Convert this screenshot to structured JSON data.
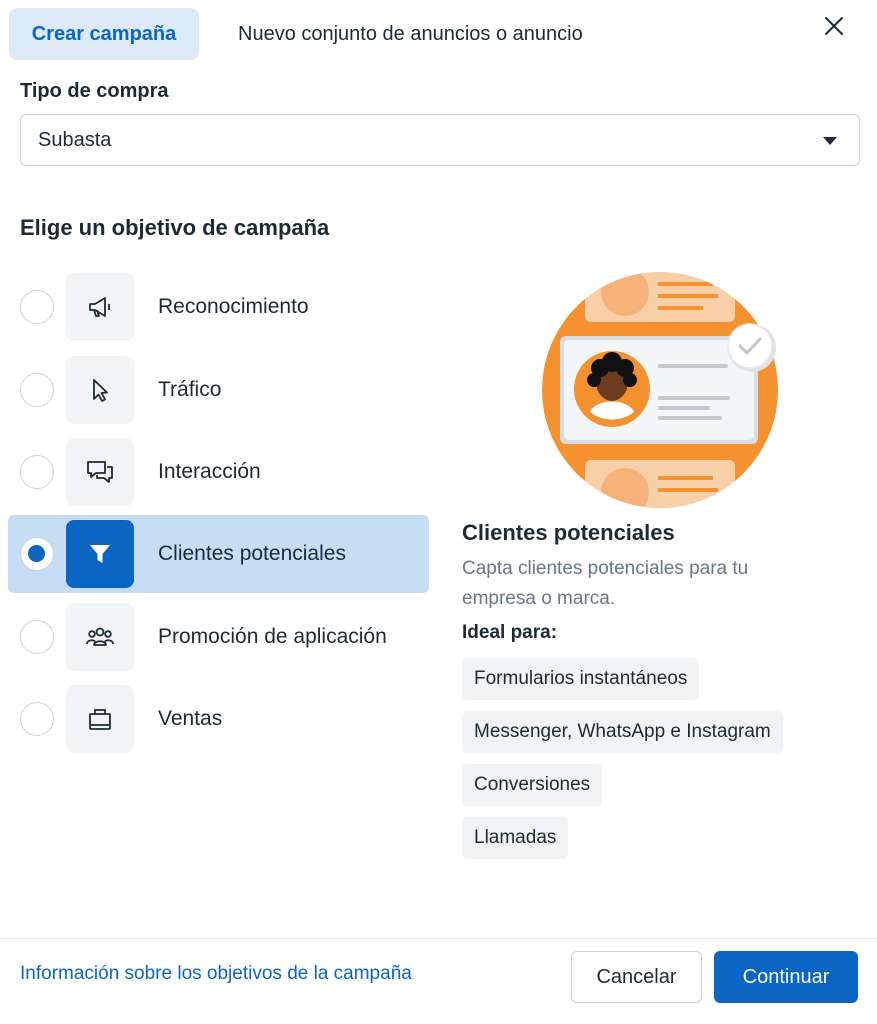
{
  "tabs": {
    "create_campaign": "Crear campaña",
    "new_ad_set": "Nuevo conjunto de anuncios o anuncio"
  },
  "purchase_type": {
    "label": "Tipo de compra",
    "selected": "Subasta"
  },
  "objectives": {
    "title": "Elige un objetivo de campaña",
    "selected_index": 3,
    "items": [
      {
        "label": "Reconocimiento",
        "icon": "megaphone-icon"
      },
      {
        "label": "Tráfico",
        "icon": "cursor-icon"
      },
      {
        "label": "Interacción",
        "icon": "chat-bubbles-icon"
      },
      {
        "label": "Clientes potenciales",
        "icon": "funnel-icon"
      },
      {
        "label": "Promoción de aplicación",
        "icon": "people-icon"
      },
      {
        "label": "Ventas",
        "icon": "shopping-bag-icon"
      }
    ]
  },
  "detail": {
    "title": "Clientes potenciales",
    "description": "Capta clientes potenciales para tu empresa o marca.",
    "ideal_label": "Ideal para:",
    "chips": [
      "Formularios instantáneos",
      "Messenger, WhatsApp e Instagram",
      "Conversiones",
      "Llamadas"
    ]
  },
  "footer": {
    "info_link": "Información sobre los objetivos de la campaña",
    "cancel": "Cancelar",
    "continue": "Continuar"
  },
  "colors": {
    "accent": "#0a66c2",
    "selected_bg": "#c7dcf5",
    "illustration_orange": "#f5922f"
  }
}
